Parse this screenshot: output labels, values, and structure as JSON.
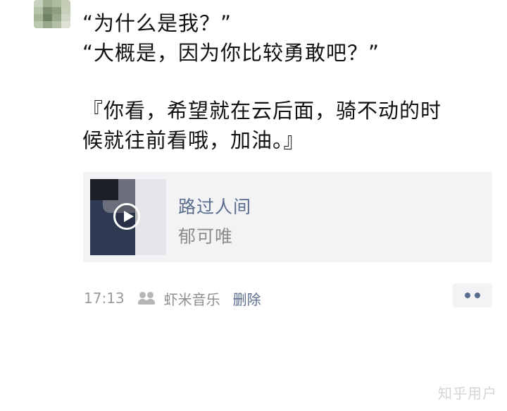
{
  "post": {
    "lines": [
      "“为什么是我？”",
      "“大概是，因为你比较勇敢吧？”",
      "『你看，希望就在云后面，骑不动的时",
      "候就往前看哦，加油。』"
    ]
  },
  "music_card": {
    "title": "路过人间",
    "artist": "郁可唯"
  },
  "meta": {
    "time": "17:13",
    "source": "虾米音乐",
    "delete_label": "删除"
  },
  "watermark": "知乎用户",
  "colors": {
    "link": "#5a6c8e",
    "meta_gray": "#9a9a9a",
    "card_bg": "#f3f3f5"
  },
  "icons": {
    "play": "play-icon",
    "visibility": "people-icon",
    "more": "more-dots-icon"
  }
}
